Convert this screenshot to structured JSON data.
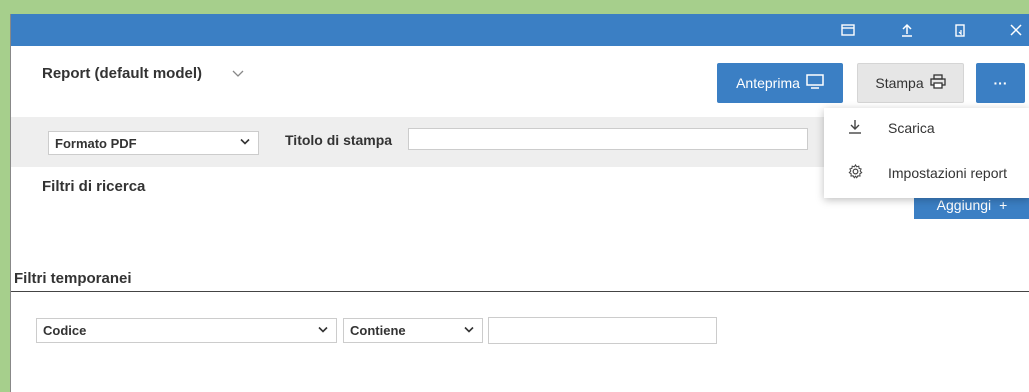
{
  "titlebar": {
    "icons": [
      "window-icon",
      "upload-icon",
      "bookmark-icon",
      "close-icon"
    ]
  },
  "header": {
    "title": "Report (default model)"
  },
  "buttons": {
    "preview_label": "Anteprima",
    "print_label": "Stampa",
    "more_label": "···"
  },
  "menu": {
    "items": [
      {
        "label": "Scarica",
        "icon": "download-icon"
      },
      {
        "label": "Impostazioni report",
        "icon": "gear-icon"
      }
    ]
  },
  "print_bar": {
    "format_value": "Formato PDF",
    "title_label": "Titolo di stampa",
    "title_value": ""
  },
  "filters": {
    "search_title": "Filtri di ricerca",
    "add_label": "Aggiungi",
    "temp_title": "Filtri temporanei",
    "field_value": "Codice",
    "operator_value": "Contiene",
    "text_value": ""
  },
  "colors": {
    "accent": "#3b7fc4",
    "frame": "#a6cf8c"
  }
}
